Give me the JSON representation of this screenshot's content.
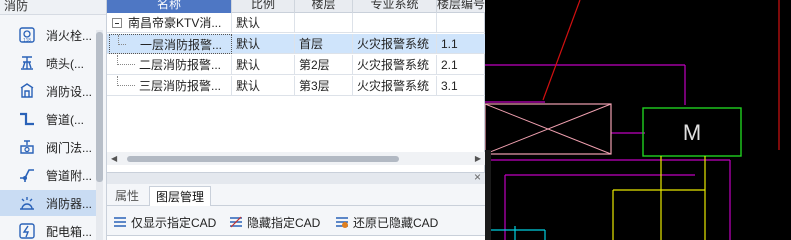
{
  "sidebar": {
    "title": "消防",
    "items": [
      {
        "label": "消火栓...",
        "icon": "hydrant-icon"
      },
      {
        "label": "喷头(...",
        "icon": "sprinkler-icon"
      },
      {
        "label": "消防设...",
        "icon": "fire-device-icon"
      },
      {
        "label": "管道(...",
        "icon": "pipe-icon"
      },
      {
        "label": "阀门法...",
        "icon": "valve-icon"
      },
      {
        "label": "管道附...",
        "icon": "pipe-fitting-icon"
      },
      {
        "label": "消防器...",
        "icon": "fire-alarm-icon"
      },
      {
        "label": "配电箱...",
        "icon": "distribution-box-icon"
      }
    ],
    "selected_index": 6
  },
  "table": {
    "headers": [
      "名称",
      "比例",
      "楼层",
      "专业系统",
      "楼层编号"
    ],
    "rows": [
      {
        "name": "南昌帝豪KTV消...",
        "scale": "默认",
        "floor": "",
        "system": "",
        "floor_no": "",
        "expandable": true
      },
      {
        "name": "一层消防报警...",
        "scale": "默认",
        "floor": "首层",
        "system": "火灾报警系统",
        "floor_no": "1.1",
        "selected": true
      },
      {
        "name": "二层消防报警...",
        "scale": "默认",
        "floor": "第2层",
        "system": "火灾报警系统",
        "floor_no": "2.1"
      },
      {
        "name": "三层消防报警...",
        "scale": "默认",
        "floor": "第3层",
        "system": "火灾报警系统",
        "floor_no": "3.1"
      }
    ]
  },
  "bottom_panel": {
    "tabs": [
      "属性",
      "图层管理"
    ],
    "active_tab": 1,
    "tools": [
      {
        "label": "仅显示指定CAD",
        "icon": "show-only-icon"
      },
      {
        "label": "隐藏指定CAD",
        "icon": "hide-icon"
      },
      {
        "label": "还原已隐藏CAD",
        "icon": "restore-icon"
      }
    ]
  },
  "cad": {
    "motor_label": "M",
    "colors": {
      "magenta": "#c000c0",
      "red": "#d01010",
      "green": "#20d020",
      "yellow": "#e8e800",
      "cyan": "#00d0e0",
      "pink": "#f0a0b0"
    }
  }
}
